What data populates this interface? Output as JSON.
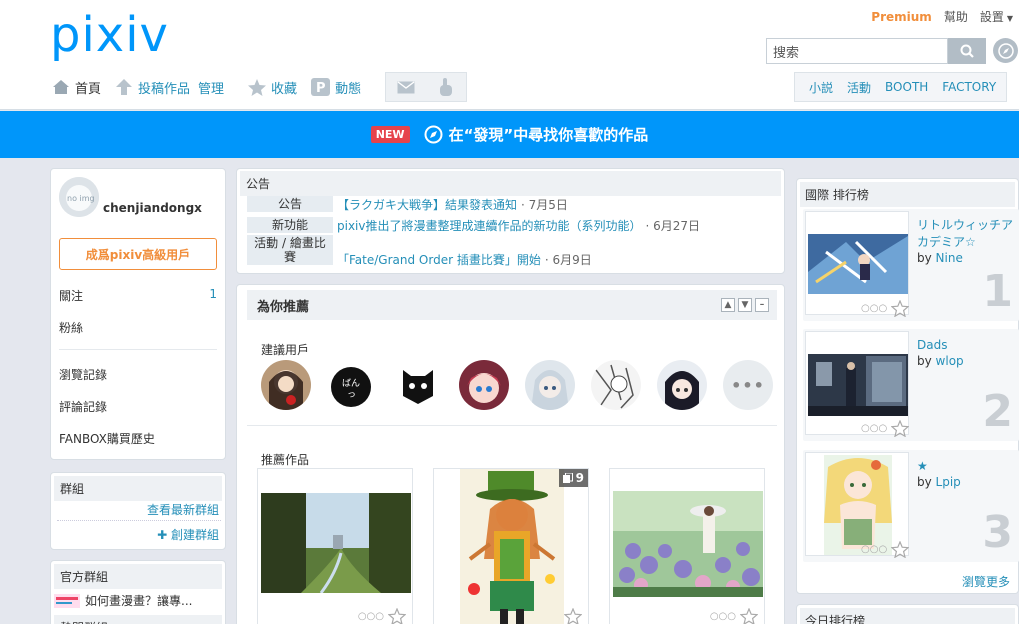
{
  "header": {
    "logo": "pixiv",
    "premium": "Premium",
    "help": "幫助",
    "settings": "設置",
    "search_placeholder": "搜索",
    "nav": {
      "home": "首頁",
      "post": "投稿作品",
      "manage": "管理",
      "bookmark": "收藏",
      "feed": "動態"
    },
    "nav_right": [
      "小説",
      "活動",
      "BOOTH",
      "FACTORY"
    ]
  },
  "banner": {
    "badge": "NEW",
    "text": "在“發現”中尋找你喜歡的作品"
  },
  "profile": {
    "username": "chenjiandongx",
    "premium_button": "成爲pixiv高級用戶",
    "following_label": "關注",
    "following_count": "1",
    "followers_label": "粉絲",
    "history": "瀏覽記錄",
    "comments": "評論記錄",
    "fanbox": "FANBOX購買歷史"
  },
  "groups": {
    "title": "群組",
    "latest": "查看最新群組",
    "create": "✚ 創建群組"
  },
  "official_groups": {
    "title": "官方群組",
    "item": "如何畫漫畫？讓專...",
    "next_title": "熱門群組"
  },
  "announce": {
    "title": "公告",
    "items": [
      {
        "label": "公告",
        "text": "【ラクガキ大戦争】結果發表通知",
        "date": "· 7月5日"
      },
      {
        "label": "新功能",
        "text": "pixiv推出了將漫畫整理成連續作品的新功能（系列功能）",
        "date": "· 6月27日"
      },
      {
        "label": "活動 / 繪畫比賽",
        "text": "「Fate/Grand Order 插畫比賽」開始",
        "date": "· 6月9日"
      }
    ]
  },
  "recommend": {
    "title": "為你推薦",
    "users_title": "建議用戶",
    "works_title": "推薦作品",
    "more": "•••",
    "page_count": "9"
  },
  "ranking": {
    "title": "國際 排行榜",
    "items": [
      {
        "title": "リトルウィッチアカデミア☆",
        "by_label": "by",
        "author": "Nine",
        "rank": "1"
      },
      {
        "title": "Dads",
        "by_label": "by",
        "author": "wlop",
        "rank": "2"
      },
      {
        "title": "★",
        "by_label": "by",
        "author": "Lpip",
        "rank": "3"
      }
    ],
    "more": "瀏覽更多",
    "daily_title": "今日排行榜"
  },
  "colors": {
    "brand": "#0096fa",
    "premium": "#f18e3b",
    "link": "#258fb8",
    "new_badge": "#e6434b"
  }
}
